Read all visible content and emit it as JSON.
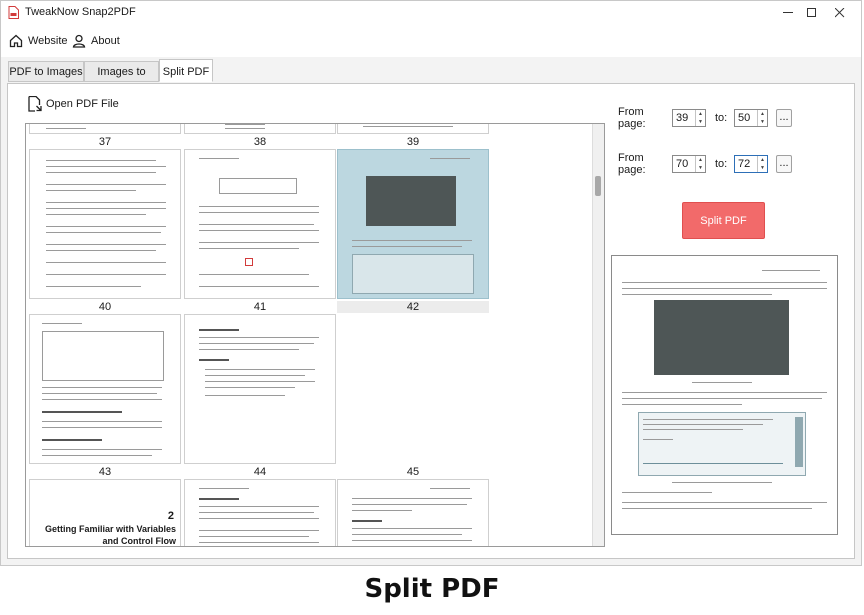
{
  "window": {
    "title": "TweakNow Snap2PDF"
  },
  "menu": {
    "website_label": "Website",
    "about_label": "About"
  },
  "tabs": [
    {
      "label": "PDF to Images"
    },
    {
      "label": "Images to PDF"
    },
    {
      "label": "Split PDF"
    }
  ],
  "toolbar": {
    "open_label": "Open PDF File"
  },
  "pages": {
    "row1": [
      "37",
      "38",
      "39"
    ],
    "row2": [
      "40",
      "41",
      "42"
    ],
    "row3": [
      "43",
      "44",
      "45"
    ],
    "selected": "42"
  },
  "thumb_text": {
    "p46_chapter_num": "2",
    "p46_title_line1": "Getting Familiar with Variables",
    "p46_title_line2": "and Control Flow"
  },
  "ranges": [
    {
      "from_label": "From page:",
      "from": "39",
      "to_label": "to:",
      "to": "50",
      "button": "..."
    },
    {
      "from_label": "From page:",
      "from": "70",
      "to_label": "to:",
      "to": "72",
      "button": "..."
    }
  ],
  "split_button": "Split PDF",
  "caption": "Split PDF",
  "colors": {
    "accent": "#f26a6a",
    "selected_thumb": "#bcd7e0"
  }
}
